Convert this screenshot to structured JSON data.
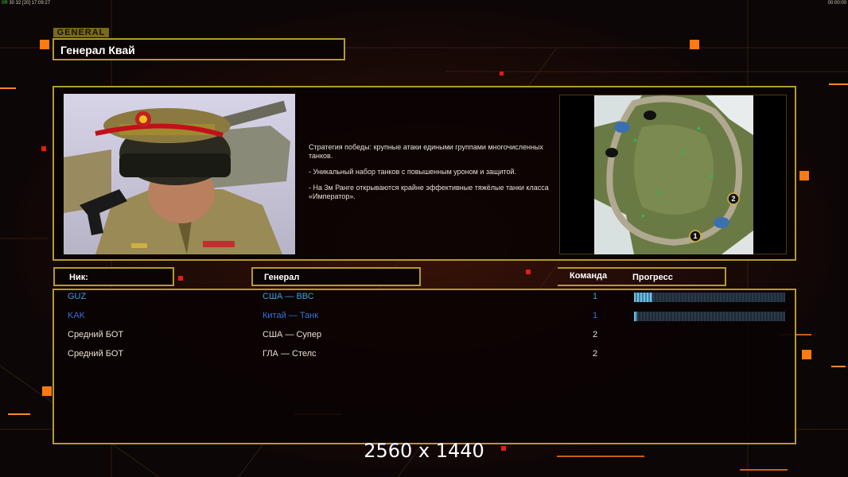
{
  "status_bar": {
    "left_prefix": "0R",
    "left_stats": "30 32 [20]",
    "left_time": "17:09:27",
    "right_time": "00:00:00"
  },
  "header": {
    "tag": "GENERAL",
    "general_name": "Генерал Квай"
  },
  "general_info": {
    "description": [
      "Стратегия победы: крупные атаки едиными группами многочисленных танков.",
      "- Уникальный набор танков с повышенным уроном и защитой.",
      "- На 3м Ранге открываются крайне эффективные тяжёлые танки класса «Император»."
    ],
    "map_markers": [
      "1",
      "2"
    ]
  },
  "table": {
    "headers": {
      "nick": "Ник:",
      "general": "Генерал",
      "team": "Команда",
      "progress": "Прогресс"
    },
    "rows": [
      {
        "nick": "GUZ",
        "general": "США — ВВС",
        "team": "1",
        "color": "#3aa0d8",
        "progress": 0.12
      },
      {
        "nick": "KAK",
        "general": "Китай — Танк",
        "team": "1",
        "color": "#3a6fd8",
        "progress": 0.02
      },
      {
        "nick": "Средний БОТ",
        "general": "США — Супер",
        "team": "2",
        "color": "#e8e0d0",
        "progress": null
      },
      {
        "nick": "Средний БОТ",
        "general": "ГЛА — Стелс",
        "team": "2",
        "color": "#e8e0d0",
        "progress": null
      }
    ]
  },
  "resolution_label": "2560 x 1440",
  "colors": {
    "frame": "#b59a2a",
    "accent_orange": "#ff7a10",
    "background": "#0d0606"
  }
}
